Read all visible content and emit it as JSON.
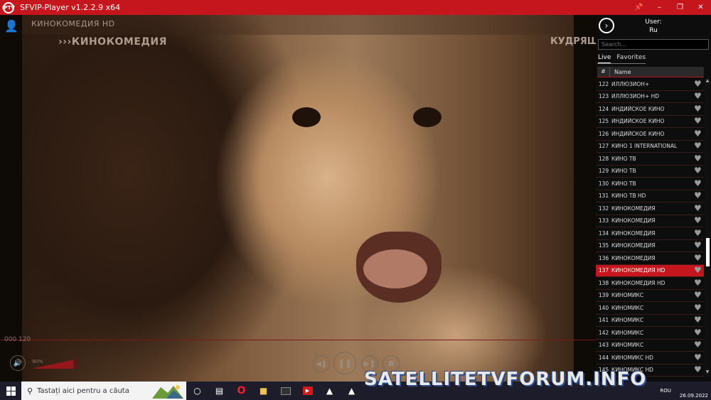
{
  "window": {
    "title": "SFVIP-Player v1.2.2.9 x64",
    "logo_text": "IPTV",
    "buttons": {
      "pin": "📌",
      "minimize": "–",
      "restore": "❐",
      "close": "✕"
    }
  },
  "video": {
    "channel_caption": "КИНОКОМЕДИЯ HD",
    "logo_left": "›››КИНОКОМЕДИЯ",
    "logo_right": "КУДРЯШ",
    "time": "000 120",
    "volume_label": "90%",
    "volume_level": 0.9
  },
  "sidebar": {
    "user_label": "User:",
    "user_value": "Ru",
    "search_placeholder": "Search...",
    "tabs": [
      {
        "label": "Live"
      },
      {
        "label": "Favorites"
      }
    ],
    "col_num": "#",
    "col_name": "Name",
    "channels": [
      {
        "num": "122",
        "name": "ИЛЛЮЗИОН+"
      },
      {
        "num": "123",
        "name": "ИЛЛЮЗИОН+ HD"
      },
      {
        "num": "124",
        "name": "ИНДИЙСКОЕ КИНО"
      },
      {
        "num": "125",
        "name": "ИНДИЙСКОЕ КИНО"
      },
      {
        "num": "126",
        "name": "ИНДИЙСКОЕ КИНО"
      },
      {
        "num": "127",
        "name": "КИНО 1 INTERNATIONAL"
      },
      {
        "num": "128",
        "name": "КИНО ТВ"
      },
      {
        "num": "129",
        "name": "КИНО ТВ"
      },
      {
        "num": "130",
        "name": "КИНО ТВ"
      },
      {
        "num": "131",
        "name": "КИНО ТВ HD"
      },
      {
        "num": "132",
        "name": "КИНОКОМЕДИЯ"
      },
      {
        "num": "133",
        "name": "КИНОКОМЕДИЯ"
      },
      {
        "num": "134",
        "name": "КИНОКОМЕДИЯ"
      },
      {
        "num": "135",
        "name": "КИНОКОМЕДИЯ"
      },
      {
        "num": "136",
        "name": "КИНОКОМЕДИЯ"
      },
      {
        "num": "137",
        "name": "КИНОКОМЕДИЯ HD"
      },
      {
        "num": "138",
        "name": "КИНОКОМЕДИЯ HD"
      },
      {
        "num": "139",
        "name": "КИНОМИКС"
      },
      {
        "num": "140",
        "name": "КИНОМИКС"
      },
      {
        "num": "141",
        "name": "КИНОМИКС"
      },
      {
        "num": "142",
        "name": "КИНОМИКС"
      },
      {
        "num": "143",
        "name": "КИНОМИКС"
      },
      {
        "num": "144",
        "name": "КИНОМИКС HD"
      },
      {
        "num": "145",
        "name": "КИНОМИКС HD"
      }
    ],
    "selected_num": "137"
  },
  "taskbar": {
    "search_placeholder": "Tastați aici pentru a căuta",
    "lang": "ROU",
    "date": "26.09.2022"
  },
  "watermark": "SATELLITETVFORUM.INFO",
  "colors": {
    "accent": "#c4161c",
    "sidebar_bg": "#0d0d0d",
    "taskbar_bg": "#1c1c2a"
  }
}
